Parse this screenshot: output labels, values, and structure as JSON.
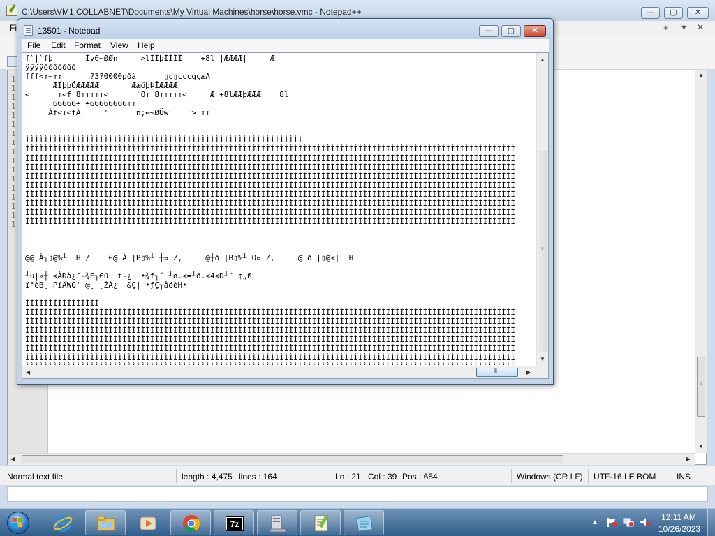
{
  "notepadpp": {
    "title": "C:\\Users\\VM1.COLLABNET\\Documents\\My Virtual Machines\\horse\\horse.vmc - Notepad++",
    "menu_first": "Fi",
    "menu_right": [
      "+",
      "▼",
      "✕"
    ],
    "line_numbers": [
      "1",
      "1",
      "1",
      "1",
      "1",
      "1",
      "1",
      "1",
      "1",
      "1",
      "1",
      "1",
      "1",
      "1",
      "1",
      "1",
      "1"
    ],
    "status": {
      "file_type": "Normal text file",
      "length": "length : 4,475",
      "lines": "lines : 164",
      "ln": "Ln : 21",
      "col": "Col : 39",
      "pos": "Pos : 654",
      "eol": "Windows (CR LF)",
      "encoding": "UTF-16 LE BOM",
      "mode": "INS"
    }
  },
  "notepad": {
    "title": "13501 - Notepad",
    "menu": [
      "File",
      "Edit",
      "Format",
      "View",
      "Help"
    ],
    "text_lines": [
      "f`|`fþ       Ìv6~ØØn     >lÌÌþÌÌÌÌ    +8l |ÆÆÆÆ|     Æ",
      "ÿÿÿÿððððððð",
      "fff<↑~↑↑      ?3?0000pðà      ▯c▯cccgçæA",
      "      ÆÏþþÖÆÆÆÆÆ       ÆæöþÞÎÆÆÆÆ",
      "<      ↑<f 8↑↑↑↑↑<      `O↑ 8↑↑↑↑↑<     Æ +8lÆÆþÆÆÆ    8l",
      "      66666÷ ÷66666666↑↑",
      "     Àf<↑<fÀ     '      n;←~ØÜw     > ↑↑",
      "",
      "",
      "ÌÌÌÌÌÌÌÌÌÌÌÌÌÌÌÌÌÌÌÌÌÌÌÌÌÌÌÌÌÌÌÌÌÌÌÌÌÌÌÌÌÌÌÌÌÌÌÌÌÌÌÌÌÌÌÌÌÌÌÌ",
      "ÌÌÌÌÌÌÌÌÌÌÌÌÌÌÌÌÌÌÌÌÌÌÌÌÌÌÌÌÌÌÌÌÌÌÌÌÌÌÌÌÌÌÌÌÌÌÌÌÌÌÌÌÌÌÌÌÌÌÌÌÌÌÌÌÌÌÌÌÌÌÌÌÌÌÌÌÌÌÌÌÌÌÌÌÌÌÌÌÌÌÌÌÌÌÌÌÌÌÌÌÌÌÌÌÌÌ",
      "ÌÌÌÌÌÌÌÌÌÌÌÌÌÌÌÌÌÌÌÌÌÌÌÌÌÌÌÌÌÌÌÌÌÌÌÌÌÌÌÌÌÌÌÌÌÌÌÌÌÌÌÌÌÌÌÌÌÌÌÌÌÌÌÌÌÌÌÌÌÌÌÌÌÌÌÌÌÌÌÌÌÌÌÌÌÌÌÌÌÌÌÌÌÌÌÌÌÌÌÌÌÌÌÌÌÌ",
      "ÌÌÌÌÌÌÌÌÌÌÌÌÌÌÌÌÌÌÌÌÌÌÌÌÌÌÌÌÌÌÌÌÌÌÌÌÌÌÌÌÌÌÌÌÌÌÌÌÌÌÌÌÌÌÌÌÌÌÌÌÌÌÌÌÌÌÌÌÌÌÌÌÌÌÌÌÌÌÌÌÌÌÌÌÌÌÌÌÌÌÌÌÌÌÌÌÌÌÌÌÌÌÌÌÌÌ",
      "ÌÌÌÌÌÌÌÌÌÌÌÌÌÌÌÌÌÌÌÌÌÌÌÌÌÌÌÌÌÌÌÌÌÌÌÌÌÌÌÌÌÌÌÌÌÌÌÌÌÌÌÌÌÌÌÌÌÌÌÌÌÌÌÌÌÌÌÌÌÌÌÌÌÌÌÌÌÌÌÌÌÌÌÌÌÌÌÌÌÌÌÌÌÌÌÌÌÌÌÌÌÌÌÌÌÌ",
      "ÌÌÌÌÌÌÌÌÌÌÌÌÌÌÌÌÌÌÌÌÌÌÌÌÌÌÌÌÌÌÌÌÌÌÌÌÌÌÌÌÌÌÌÌÌÌÌÌÌÌÌÌÌÌÌÌÌÌÌÌÌÌÌÌÌÌÌÌÌÌÌÌÌÌÌÌÌÌÌÌÌÌÌÌÌÌÌÌÌÌÌÌÌÌÌÌÌÌÌÌÌÌÌÌÌÌ",
      "ÌÌÌÌÌÌÌÌÌÌÌÌÌÌÌÌÌÌÌÌÌÌÌÌÌÌÌÌÌÌÌÌÌÌÌÌÌÌÌÌÌÌÌÌÌÌÌÌÌÌÌÌÌÌÌÌÌÌÌÌÌÌÌÌÌÌÌÌÌÌÌÌÌÌÌÌÌÌÌÌÌÌÌÌÌÌÌÌÌÌÌÌÌÌÌÌÌÌÌÌÌÌÌÌÌÌ",
      "ÌÌÌÌÌÌÌÌÌÌÌÌÌÌÌÌÌÌÌÌÌÌÌÌÌÌÌÌÌÌÌÌÌÌÌÌÌÌÌÌÌÌÌÌÌÌÌÌÌÌÌÌÌÌÌÌÌÌÌÌÌÌÌÌÌÌÌÌÌÌÌÌÌÌÌÌÌÌÌÌÌÌÌÌÌÌÌÌÌÌÌÌÌÌÌÌÌÌÌÌÌÌÌÌÌÌ",
      "ÌÌÌÌÌÌÌÌÌÌÌÌÌÌÌÌÌÌÌÌÌÌÌÌÌÌÌÌÌÌÌÌÌÌÌÌÌÌÌÌÌÌÌÌÌÌÌÌÌÌÌÌÌÌÌÌÌÌÌÌÌÌÌÌÌÌÌÌÌÌÌÌÌÌÌÌÌÌÌÌÌÌÌÌÌÌÌÌÌÌÌÌÌÌÌÌÌÌÌÌÌÌÌÌÌÌ",
      "ÌÌÌÌÌÌÌÌÌÌÌÌÌÌÌÌÌÌÌÌÌÌÌÌÌÌÌÌÌÌÌÌÌÌÌÌÌÌÌÌÌÌÌÌÌÌÌÌÌÌÌÌÌÌÌÌÌÌÌÌÌÌÌÌÌÌÌÌÌÌÌÌÌÌÌÌÌÌÌÌÌÌÌÌÌÌÌÌÌÌÌÌÌÌÌÌÌÌÌÌÌÌÌÌÌÌ",
      "",
      "",
      "",
      "@@ À┐▯@%┴  H /    €@ À |B▯%┴ ┼▫ Z,     @┼ð |B▯%┴ O▫ Z,     @ ð |▯@<|  H",
      "",
      "┘u|»┼ <ÀÐà¿£-¾E┐€ü  t-¿  •¾f┐´ ┘ø.<=┘ð.<4<D┘¨ ¢„ß",
      "ï°èB¸ PïÂWQ' @¸ ¸ŽÀ¿  &Ç| •ƒÇ┐âöèH•",
      "",
      "ÌÌÌÌÌÌÌÌÌÌÌÌÌÌÌÌ",
      "ÌÌÌÌÌÌÌÌÌÌÌÌÌÌÌÌÌÌÌÌÌÌÌÌÌÌÌÌÌÌÌÌÌÌÌÌÌÌÌÌÌÌÌÌÌÌÌÌÌÌÌÌÌÌÌÌÌÌÌÌÌÌÌÌÌÌÌÌÌÌÌÌÌÌÌÌÌÌÌÌÌÌÌÌÌÌÌÌÌÌÌÌÌÌÌÌÌÌÌÌÌÌÌÌÌÌ",
      "ÌÌÌÌÌÌÌÌÌÌÌÌÌÌÌÌÌÌÌÌÌÌÌÌÌÌÌÌÌÌÌÌÌÌÌÌÌÌÌÌÌÌÌÌÌÌÌÌÌÌÌÌÌÌÌÌÌÌÌÌÌÌÌÌÌÌÌÌÌÌÌÌÌÌÌÌÌÌÌÌÌÌÌÌÌÌÌÌÌÌÌÌÌÌÌÌÌÌÌÌÌÌÌÌÌÌ",
      "ÌÌÌÌÌÌÌÌÌÌÌÌÌÌÌÌÌÌÌÌÌÌÌÌÌÌÌÌÌÌÌÌÌÌÌÌÌÌÌÌÌÌÌÌÌÌÌÌÌÌÌÌÌÌÌÌÌÌÌÌÌÌÌÌÌÌÌÌÌÌÌÌÌÌÌÌÌÌÌÌÌÌÌÌÌÌÌÌÌÌÌÌÌÌÌÌÌÌÌÌÌÌÌÌÌÌ",
      "ÌÌÌÌÌÌÌÌÌÌÌÌÌÌÌÌÌÌÌÌÌÌÌÌÌÌÌÌÌÌÌÌÌÌÌÌÌÌÌÌÌÌÌÌÌÌÌÌÌÌÌÌÌÌÌÌÌÌÌÌÌÌÌÌÌÌÌÌÌÌÌÌÌÌÌÌÌÌÌÌÌÌÌÌÌÌÌÌÌÌÌÌÌÌÌÌÌÌÌÌÌÌÌÌÌÌ",
      "ÌÌÌÌÌÌÌÌÌÌÌÌÌÌÌÌÌÌÌÌÌÌÌÌÌÌÌÌÌÌÌÌÌÌÌÌÌÌÌÌÌÌÌÌÌÌÌÌÌÌÌÌÌÌÌÌÌÌÌÌÌÌÌÌÌÌÌÌÌÌÌÌÌÌÌÌÌÌÌÌÌÌÌÌÌÌÌÌÌÌÌÌÌÌÌÌÌÌÌÌÌÌÌÌÌÌ",
      "ÌÌÌÌÌÌÌÌÌÌÌÌÌÌÌÌÌÌÌÌÌÌÌÌÌÌÌÌÌÌÌÌÌÌÌÌÌÌÌÌÌÌÌÌÌÌÌÌÌÌÌÌÌÌÌÌÌÌÌÌÌÌÌÌÌÌÌÌÌÌÌÌÌÌÌÌÌÌÌÌÌÌÌÌÌÌÌÌÌÌÌÌÌÌÌÌÌÌÌÌÌÌÌÌÌÌ",
      "ÌÌÌÌÌÌÌÌÌÌÌÌÌÌÌÌÌÌÌÌÌÌÌÌÌÌÌÌÌÌÌÌÌÌÌÌÌÌÌÌÌÌÌÌÌÌÌÌÌÌÌÌÌÌÌÌÌÌÌÌÌÌÌÌÌÌÌÌÌÌÌÌÌÌÌÌÌÌÌÌÌÌÌÌÌÌÌÌÌÌÌÌÌÌÌÌÌÌÌÌÌÌÌÌÌÌ",
      "ÌÌÌÌÌÌÌÌÌÌÌÌÌÌÌÌÌÌÌÌÌÌÌÌÌÌÌÌÌÌÌÌÌÌÌÌÌÌÌÌÌÌÌÌÌÌÌÌÌÌÌÌÌÌÌÌÌÌÌÌÌÌÌÌÌÌÌÌÌÌÌÌÌÌÌÌÌÌÌÌÌÌÌÌÌÌÌÌÌÌÌÌÌÌÌÌÌÌÌÌÌÌÌÌÌÌ",
      "ÌÌÌÌÌÌÌÌÌÌÌÌÌÌÌÌÌÌÌÌÌÌÌÌÌÌÌÌÌÌÌÌÌÌÌÌÌÌÌÌÌÌÌÌÌÌÌÌÌÌÌÌÌÌÌÌÌÌÌÌÌÌÌÌÌÌÌÌÌÌÌÌÌÌÌÌÌÌÌÌÌÌÌÌÌÌÌÌÌÌÌÌÌÌÌÌÌÌÌÌÌÌÌÌÌÌ",
      "ÌÌÌÌÌÌÌÌÌÌÌÌÌÌÌÌÌÌÌÌÌÌÌÌÌÌÌÌÌÌÌÌÌÌÌÌÌÌÌÌÌÌÌÌÌÌÌÌÌÌÌÌÌÌÌÌÌÌÌÌÌÌÌÌÌÌÌÌÌÌÌÌÌÌÌÌÌÌÌÌÌÌÌÌÌÌÌÌÌÌÌÌÌÌÌÌÌÌÌÌÌÌÌÌÌÌ"
    ]
  },
  "window_controls": {
    "minimize": "—",
    "maximize": "▢",
    "close": "✕"
  },
  "taskbar": {
    "apps": [
      "internet-explorer",
      "file-explorer",
      "media-player",
      "chrome",
      "7-zip",
      "system-config",
      "notepad-plus-plus",
      "notepad"
    ],
    "tray": {
      "up_arrow": "▲",
      "time": "12:11 AM",
      "date": "10/26/2023"
    }
  },
  "colors": {
    "taskbar": "#2f5d8a",
    "title_active": "#c3d4e9",
    "close_button": "#c24b31",
    "scroll_thumb_accent": "#3c7fb1"
  }
}
